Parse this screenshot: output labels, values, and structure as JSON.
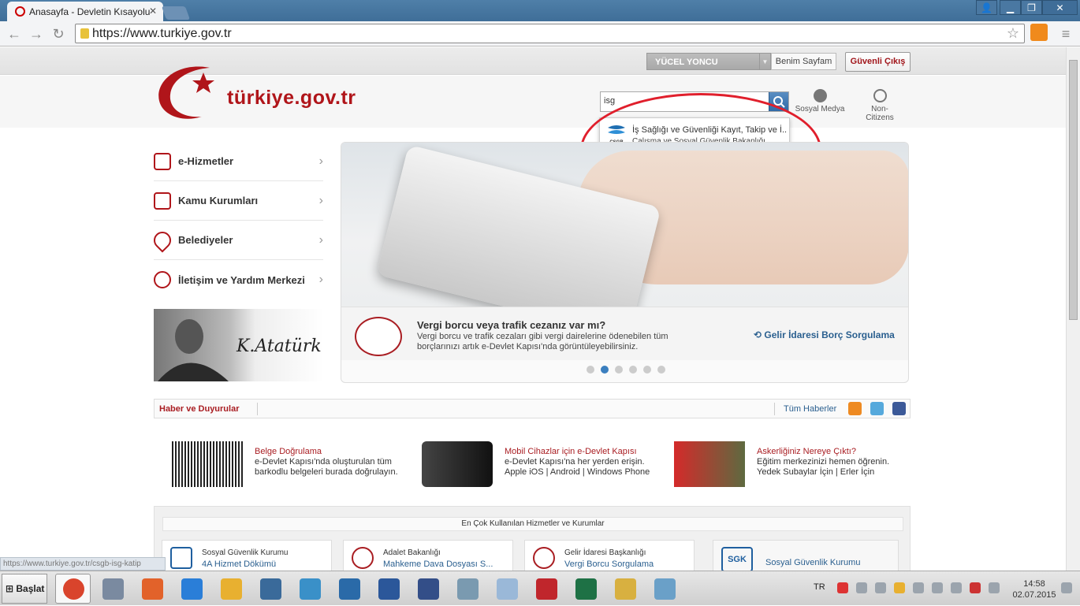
{
  "browser": {
    "tab_title": "Anasayfa - Devletin Kısayolu",
    "url": "https://www.turkiye.gov.tr"
  },
  "site": {
    "user_name": "YÜCEL YONCU",
    "my_page": "Benim Sayfam",
    "logout": "Güvenli Çıkış",
    "logo_text": "türkiye.gov.tr",
    "search_value": "isg",
    "social_media": "Sosyal Medya",
    "non_citizens": "Non-Citizens",
    "suggestion": {
      "title": "İş Sağlığı ve Güvenliği Kayıt, Takip ve İ..",
      "subtitle": "Çalışma ve Sosyal Güvenlik Bakanlığı",
      "logo_label": "CSGB"
    },
    "left_nav": [
      {
        "label": "e-Hizmetler"
      },
      {
        "label": "Kamu Kurumları"
      },
      {
        "label": "Belediyeler"
      },
      {
        "label": "İletişim ve Yardım Merkezi"
      }
    ],
    "slide": {
      "title": "Vergi borcu veya trafik cezanız var mı?",
      "desc": "Vergi borcu ve trafik cezaları gibi vergi dairelerine ödenebilen tüm borçlarınızı artık e-Devlet Kapısı'nda görüntüleyebilirsiniz.",
      "link": "Gelir İdaresi Borç Sorgulama",
      "dots_total": 6,
      "dot_active": 2
    },
    "news": {
      "title": "Haber ve Duyurular",
      "all": "Tüm Haberler"
    },
    "promos": [
      {
        "title": "Belge Doğrulama",
        "lines": [
          "e-Devlet Kapısı'nda oluşturulan tüm",
          "barkodlu belgeleri burada doğrulayın."
        ]
      },
      {
        "title": "Mobil Cihazlar için e-Devlet Kapısı",
        "lines": [
          "e-Devlet Kapısı'na her yerden erişin.",
          "Apple iOS | Android | Windows Phone"
        ]
      },
      {
        "title": "Askerliğiniz Nereye Çıktı?",
        "lines": [
          "Eğitim merkezinizi hemen öğrenin.",
          "Yedek Subaylar İçin | Erler İçin"
        ]
      }
    ],
    "services_title": "En Çok Kullanılan Hizmetler ve Kurumlar",
    "services": [
      {
        "org": "Sosyal Güvenlik Kurumu",
        "service": "4A Hizmet Dökümü"
      },
      {
        "org": "Adalet Bakanlığı",
        "service": "Mahkeme Dava Dosyası S..."
      },
      {
        "org": "Gelir İdaresi Başkanlığı",
        "service": "Vergi Borcu Sorgulama"
      }
    ],
    "right_box_org": "Sosyal Güvenlik Kurumu",
    "sgk_label": "SGK",
    "status_url": "https://www.turkiye.gov.tr/csgb-isg-katip"
  },
  "taskbar": {
    "start_label": "Başlat",
    "lang": "TR",
    "time": "14:58",
    "date": "02.07.2015",
    "apps": [
      "chrome-icon",
      "pen-icon",
      "kalkan-icon",
      "ie-icon",
      "outlook-icon",
      "monitor-icon",
      "bs-icon",
      "media-icon",
      "word-icon",
      "forum-icon",
      "calculator-icon",
      "notes-icon",
      "pdf-icon",
      "excel-icon",
      "folder-icon",
      "paint-icon"
    ]
  },
  "colors": {
    "brand_red": "#b0151a",
    "link_blue": "#2a5f8f",
    "annotation_red": "#e01f2c"
  }
}
